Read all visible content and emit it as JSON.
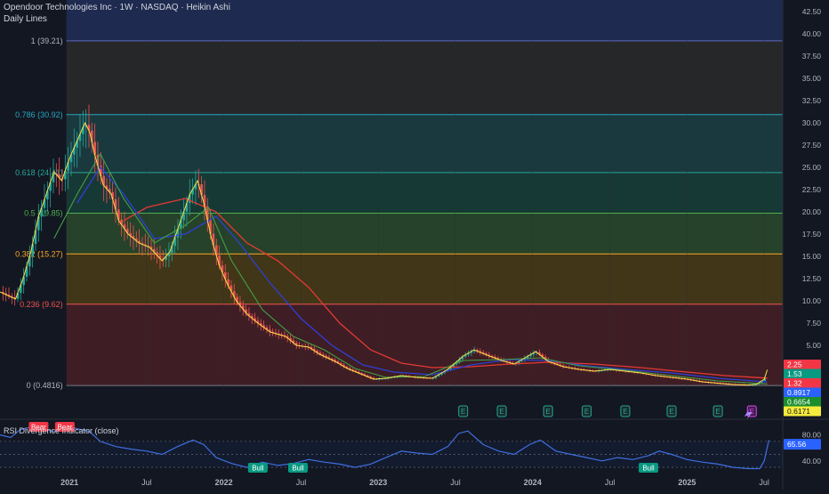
{
  "header": {
    "title": "Opendoor Technologies Inc · 1W · NASDAQ · Heikin Ashi",
    "subtitle": "Daily Lines"
  },
  "rsi_title": "RSI Divergence Indicator (close)",
  "chart_data": {
    "type": "candlestick",
    "ylim": [
      0,
      43.5
    ],
    "y_ticks": [
      "42.50",
      "40.00",
      "37.50",
      "35.00",
      "32.50",
      "30.00",
      "27.50",
      "25.00",
      "22.50",
      "20.00",
      "17.50",
      "15.00",
      "12.50",
      "10.00",
      "7.50",
      "5.00",
      "2.50"
    ],
    "y_tick_values": [
      42.5,
      40,
      37.5,
      35,
      32.5,
      30,
      27.5,
      25,
      22.5,
      20,
      17.5,
      15,
      12.5,
      10,
      7.5,
      5,
      2.5
    ],
    "x_ticks": [
      {
        "label": "2021",
        "t": 2021.0
      },
      {
        "label": "Jul",
        "t": 2021.5
      },
      {
        "label": "2022",
        "t": 2022.0
      },
      {
        "label": "Jul",
        "t": 2022.5
      },
      {
        "label": "2023",
        "t": 2023.0
      },
      {
        "label": "Jul",
        "t": 2023.5
      },
      {
        "label": "2024",
        "t": 2024.0
      },
      {
        "label": "Jul",
        "t": 2024.5
      },
      {
        "label": "2025",
        "t": 2025.0
      },
      {
        "label": "Jul",
        "t": 2025.5
      }
    ],
    "fib_levels": [
      {
        "ratio": "1",
        "label": "1 (39.21)",
        "value": 39.21,
        "line": "#5b6bc0",
        "fill": "#2a2a2a",
        "text": "#b0b3bb"
      },
      {
        "ratio": "0.786",
        "label": "0.786 (30.92)",
        "value": 30.92,
        "line": "#26a6c0",
        "fill": "#1c3f44",
        "text": "#26a6c0"
      },
      {
        "ratio": "0.618",
        "label": "0.618 (24.41)",
        "value": 24.41,
        "line": "#26a69a",
        "fill": "#193f3a",
        "text": "#26a69a"
      },
      {
        "ratio": "0.5",
        "label": "0.5 (19.85)",
        "value": 19.85,
        "line": "#4caf50",
        "fill": "#2a4a2c",
        "text": "#4caf50"
      },
      {
        "ratio": "0.382",
        "label": "0.382 (15.27)",
        "value": 15.27,
        "line": "#f9a825",
        "fill": "#4a3c16",
        "text": "#f9a825"
      },
      {
        "ratio": "0.236",
        "label": "0.236 (9.62)",
        "value": 9.62,
        "line": "#ef5350",
        "fill": "#472025",
        "text": "#ef5350"
      },
      {
        "ratio": "0",
        "label": "0 (0.4816)",
        "value": 0.4816,
        "line": "#787b86",
        "fill": "#1f2530",
        "text": "#b0b3bb"
      }
    ],
    "top_fill": "#1e2a4f",
    "price_path": [
      [
        2020.55,
        11.0
      ],
      [
        2020.6,
        10.6
      ],
      [
        2020.65,
        10.2
      ],
      [
        2020.7,
        12.5
      ],
      [
        2020.75,
        15.5
      ],
      [
        2020.8,
        19.5
      ],
      [
        2020.85,
        22.0
      ],
      [
        2020.9,
        24.5
      ],
      [
        2020.95,
        23.5
      ],
      [
        2021.0,
        26.0
      ],
      [
        2021.05,
        28.0
      ],
      [
        2021.1,
        30.0
      ],
      [
        2021.13,
        29.0
      ],
      [
        2021.17,
        26.0
      ],
      [
        2021.22,
        23.0
      ],
      [
        2021.27,
        22.0
      ],
      [
        2021.32,
        19.0
      ],
      [
        2021.38,
        17.5
      ],
      [
        2021.45,
        16.5
      ],
      [
        2021.52,
        16.0
      ],
      [
        2021.6,
        14.5
      ],
      [
        2021.65,
        15.5
      ],
      [
        2021.72,
        19.0
      ],
      [
        2021.78,
        22.0
      ],
      [
        2021.83,
        23.5
      ],
      [
        2021.87,
        21.0
      ],
      [
        2021.92,
        17.0
      ],
      [
        2021.97,
        14.0
      ],
      [
        2022.02,
        12.0
      ],
      [
        2022.08,
        10.0
      ],
      [
        2022.15,
        8.5
      ],
      [
        2022.22,
        7.5
      ],
      [
        2022.3,
        6.5
      ],
      [
        2022.4,
        6.0
      ],
      [
        2022.47,
        5.0
      ],
      [
        2022.55,
        4.8
      ],
      [
        2022.62,
        4.0
      ],
      [
        2022.72,
        3.2
      ],
      [
        2022.8,
        2.4
      ],
      [
        2022.9,
        1.7
      ],
      [
        2022.97,
        1.2
      ],
      [
        2023.05,
        1.3
      ],
      [
        2023.15,
        1.6
      ],
      [
        2023.25,
        1.4
      ],
      [
        2023.35,
        1.3
      ],
      [
        2023.45,
        2.3
      ],
      [
        2023.55,
        3.8
      ],
      [
        2023.62,
        4.5
      ],
      [
        2023.72,
        3.8
      ],
      [
        2023.8,
        3.3
      ],
      [
        2023.88,
        2.9
      ],
      [
        2023.95,
        3.6
      ],
      [
        2024.02,
        4.3
      ],
      [
        2024.1,
        3.2
      ],
      [
        2024.2,
        2.6
      ],
      [
        2024.3,
        2.3
      ],
      [
        2024.4,
        2.1
      ],
      [
        2024.5,
        2.3
      ],
      [
        2024.6,
        2.1
      ],
      [
        2024.7,
        1.9
      ],
      [
        2024.8,
        1.6
      ],
      [
        2024.9,
        1.4
      ],
      [
        2025.0,
        1.2
      ],
      [
        2025.1,
        0.9
      ],
      [
        2025.2,
        0.75
      ],
      [
        2025.3,
        0.6
      ],
      [
        2025.4,
        0.55
      ],
      [
        2025.45,
        0.62
      ],
      [
        2025.5,
        1.2
      ],
      [
        2025.52,
        2.25
      ]
    ],
    "ma_red": [
      [
        2021.35,
        19.0
      ],
      [
        2021.5,
        20.5
      ],
      [
        2021.75,
        21.5
      ],
      [
        2021.95,
        20.0
      ],
      [
        2022.15,
        16.5
      ],
      [
        2022.35,
        14.5
      ],
      [
        2022.55,
        11.5
      ],
      [
        2022.75,
        7.5
      ],
      [
        2022.95,
        4.5
      ],
      [
        2023.15,
        3.0
      ],
      [
        2023.35,
        2.5
      ],
      [
        2023.6,
        2.6
      ],
      [
        2023.85,
        2.9
      ],
      [
        2024.1,
        3.1
      ],
      [
        2024.4,
        2.9
      ],
      [
        2024.7,
        2.5
      ],
      [
        2025.0,
        2.0
      ],
      [
        2025.25,
        1.6
      ],
      [
        2025.52,
        1.32
      ]
    ],
    "ma_blue": [
      [
        2021.05,
        21.0
      ],
      [
        2021.2,
        25.0
      ],
      [
        2021.35,
        22.0
      ],
      [
        2021.55,
        17.0
      ],
      [
        2021.75,
        17.5
      ],
      [
        2021.95,
        19.5
      ],
      [
        2022.1,
        16.5
      ],
      [
        2022.3,
        12.0
      ],
      [
        2022.5,
        8.0
      ],
      [
        2022.7,
        5.0
      ],
      [
        2022.9,
        2.8
      ],
      [
        2023.1,
        2.0
      ],
      [
        2023.35,
        1.7
      ],
      [
        2023.6,
        2.8
      ],
      [
        2023.85,
        3.4
      ],
      [
        2024.1,
        3.3
      ],
      [
        2024.35,
        2.7
      ],
      [
        2024.6,
        2.3
      ],
      [
        2024.9,
        1.9
      ],
      [
        2025.2,
        1.3
      ],
      [
        2025.52,
        0.89
      ]
    ],
    "ma_green": [
      [
        2020.9,
        17.0
      ],
      [
        2021.05,
        22.0
      ],
      [
        2021.2,
        26.5
      ],
      [
        2021.35,
        21.5
      ],
      [
        2021.55,
        16.5
      ],
      [
        2021.75,
        18.5
      ],
      [
        2021.9,
        20.5
      ],
      [
        2022.05,
        14.5
      ],
      [
        2022.25,
        9.0
      ],
      [
        2022.45,
        6.0
      ],
      [
        2022.65,
        4.5
      ],
      [
        2022.85,
        2.4
      ],
      [
        2023.05,
        1.4
      ],
      [
        2023.3,
        1.5
      ],
      [
        2023.55,
        3.3
      ],
      [
        2023.8,
        3.4
      ],
      [
        2024.05,
        3.6
      ],
      [
        2024.3,
        2.7
      ],
      [
        2024.6,
        2.2
      ],
      [
        2024.9,
        1.6
      ],
      [
        2025.2,
        1.0
      ],
      [
        2025.52,
        0.67
      ]
    ],
    "price_badges": [
      {
        "label": "2.25",
        "color": "#f23645",
        "text": "#ffffff"
      },
      {
        "label": "1.53",
        "color": "#089981",
        "text": "#ffffff"
      },
      {
        "label": "1.32",
        "color": "#f23645",
        "text": "#ffffff"
      },
      {
        "label": "0.8917",
        "color": "#2962ff",
        "text": "#ffffff"
      },
      {
        "label": "0.6654",
        "color": "#1b8e2c",
        "text": "#ffffff"
      },
      {
        "label": "0.6171",
        "color": "#f5eb3b",
        "text": "#131722"
      }
    ],
    "earnings_label": "E",
    "earnings_t": [
      2023.55,
      2023.8,
      2024.1,
      2024.35,
      2024.6,
      2024.9,
      2025.2,
      2025.42
    ],
    "earnings_active_label": "E",
    "rsi": {
      "y_ticks": [
        "80.00",
        "40.00"
      ],
      "y_tick_values": [
        80,
        40
      ],
      "ylim": [
        15,
        100
      ],
      "last_value": "65.56",
      "series": [
        [
          2020.55,
          80
        ],
        [
          2020.62,
          76
        ],
        [
          2020.68,
          88
        ],
        [
          2020.75,
          92
        ],
        [
          2020.82,
          90
        ],
        [
          2020.9,
          85
        ],
        [
          2021.0,
          92
        ],
        [
          2021.08,
          88
        ],
        [
          2021.13,
          85
        ],
        [
          2021.2,
          70
        ],
        [
          2021.3,
          62
        ],
        [
          2021.4,
          58
        ],
        [
          2021.5,
          55
        ],
        [
          2021.6,
          50
        ],
        [
          2021.7,
          62
        ],
        [
          2021.8,
          72
        ],
        [
          2021.87,
          65
        ],
        [
          2021.95,
          45
        ],
        [
          2022.05,
          36
        ],
        [
          2022.15,
          30
        ],
        [
          2022.25,
          38
        ],
        [
          2022.35,
          33
        ],
        [
          2022.45,
          36
        ],
        [
          2022.55,
          42
        ],
        [
          2022.65,
          38
        ],
        [
          2022.75,
          35
        ],
        [
          2022.85,
          30
        ],
        [
          2022.95,
          35
        ],
        [
          2023.05,
          45
        ],
        [
          2023.15,
          55
        ],
        [
          2023.25,
          52
        ],
        [
          2023.35,
          50
        ],
        [
          2023.45,
          62
        ],
        [
          2023.52,
          82
        ],
        [
          2023.58,
          86
        ],
        [
          2023.68,
          65
        ],
        [
          2023.78,
          55
        ],
        [
          2023.88,
          50
        ],
        [
          2023.98,
          65
        ],
        [
          2024.05,
          72
        ],
        [
          2024.15,
          55
        ],
        [
          2024.25,
          50
        ],
        [
          2024.35,
          45
        ],
        [
          2024.45,
          40
        ],
        [
          2024.55,
          45
        ],
        [
          2024.65,
          42
        ],
        [
          2024.75,
          48
        ],
        [
          2024.82,
          55
        ],
        [
          2024.9,
          50
        ],
        [
          2025.0,
          42
        ],
        [
          2025.1,
          38
        ],
        [
          2025.2,
          35
        ],
        [
          2025.3,
          30
        ],
        [
          2025.4,
          28
        ],
        [
          2025.47,
          28
        ],
        [
          2025.5,
          40
        ],
        [
          2025.53,
          72
        ]
      ],
      "bear_labels": [
        {
          "label": "Bear",
          "t": 2020.8
        },
        {
          "label": "Bear",
          "t": 2020.97
        }
      ],
      "bull_labels": [
        {
          "label": "Bull",
          "t": 2022.22
        },
        {
          "label": "Bull",
          "t": 2022.48
        },
        {
          "label": "Bull",
          "t": 2024.75
        }
      ]
    }
  }
}
